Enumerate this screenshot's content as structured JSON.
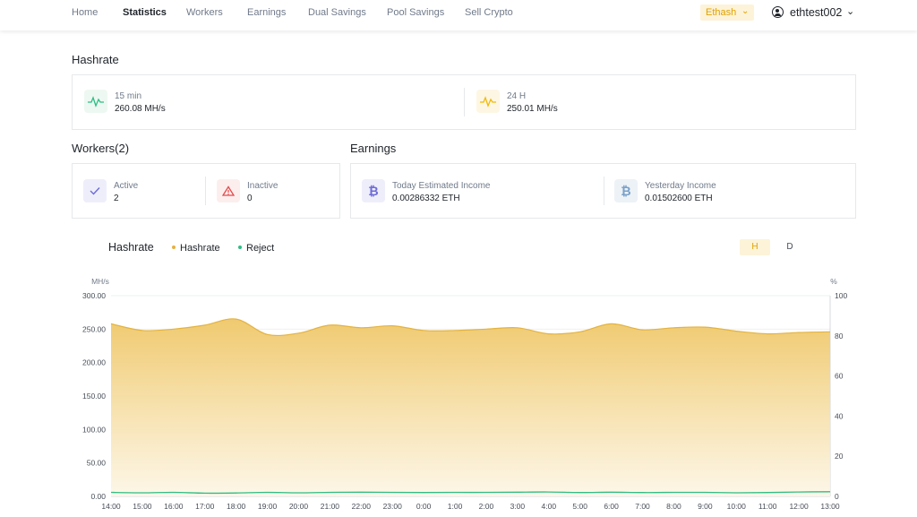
{
  "nav": {
    "items": [
      "Home",
      "Statistics",
      "Workers",
      "Earnings",
      "Dual Savings",
      "Pool Savings",
      "Sell Crypto"
    ],
    "active": "Statistics",
    "algo": "Ethash",
    "username": "ethtest002"
  },
  "hashrate": {
    "title": "Hashrate",
    "m15": {
      "label": "15 min",
      "value": "260.08 MH/s",
      "icon": "pulse-icon"
    },
    "h24": {
      "label": "24 H",
      "value": "250.01 MH/s",
      "icon": "pulse-icon"
    }
  },
  "workers": {
    "title": "Workers(2)",
    "active": {
      "label": "Active",
      "value": "2",
      "icon": "check-icon"
    },
    "inactive": {
      "label": "Inactive",
      "value": "0",
      "icon": "warning-icon"
    }
  },
  "earnings": {
    "title": "Earnings",
    "today": {
      "label": "Today Estimated Income",
      "value": "0.00286332 ETH",
      "icon": "bitcoin-icon"
    },
    "yesterday": {
      "label": "Yesterday Income",
      "value": "0.01502600 ETH",
      "icon": "bitcoin-icon"
    }
  },
  "chart_controls": {
    "title": "Hashrate",
    "toggles": [
      "H",
      "D"
    ],
    "selected": "H"
  },
  "colors": {
    "hashrate": "#f0b90b",
    "reject": "#2ebd85",
    "accent": "#e0a100"
  },
  "chart_data": {
    "type": "area",
    "legend": [
      "Hashrate",
      "Reject"
    ],
    "legend_position": "top-left",
    "grid": true,
    "y_left": {
      "label": "MH/s",
      "range": [
        0,
        300
      ],
      "ticks": [
        "0.00",
        "50.00",
        "100.00",
        "150.00",
        "200.00",
        "250.00",
        "300.00"
      ]
    },
    "y_right": {
      "label": "%",
      "range": [
        0,
        100
      ],
      "ticks": [
        "0",
        "20",
        "40",
        "60",
        "80",
        "100"
      ]
    },
    "x": [
      "14:00",
      "15:00",
      "16:00",
      "17:00",
      "18:00",
      "19:00",
      "20:00",
      "21:00",
      "22:00",
      "23:00",
      "0:00",
      "1:00",
      "2:00",
      "3:00",
      "4:00",
      "5:00",
      "6:00",
      "7:00",
      "8:00",
      "9:00",
      "10:00",
      "11:00",
      "12:00",
      "13:00"
    ],
    "series": [
      {
        "name": "Hashrate",
        "axis": "left",
        "values": [
          258,
          248,
          250,
          256,
          265,
          242,
          244,
          256,
          252,
          255,
          248,
          248,
          250,
          252,
          243,
          246,
          258,
          249,
          252,
          253,
          247,
          243,
          245,
          246
        ]
      },
      {
        "name": "Reject",
        "axis": "right",
        "values": [
          2,
          1.8,
          2,
          1.6,
          1.7,
          2,
          1.8,
          2,
          2.1,
          2,
          1.9,
          2,
          2,
          2.1,
          2.2,
          1.9,
          2.1,
          1.9,
          2,
          2,
          1.8,
          1.9,
          2.2,
          2.3
        ]
      }
    ]
  }
}
